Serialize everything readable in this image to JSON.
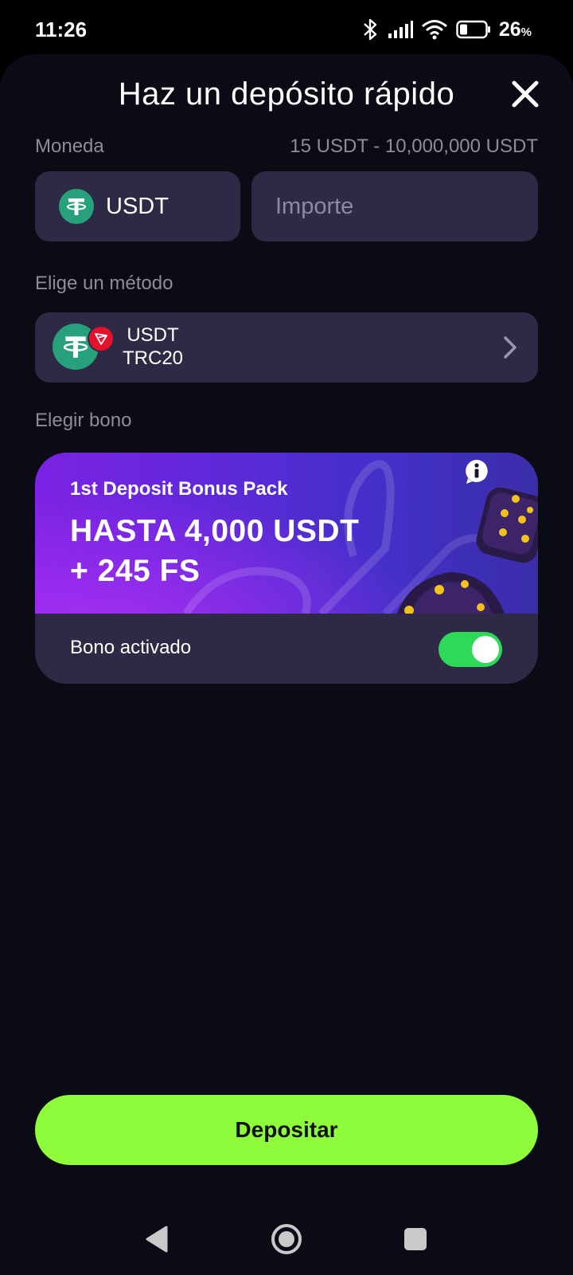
{
  "status_bar": {
    "time": "11:26",
    "battery_percent": "26",
    "battery_unit": "%",
    "icons": [
      "bluetooth-icon",
      "signal-icon",
      "wifi-icon",
      "battery-icon"
    ]
  },
  "header": {
    "title": "Haz un depósito rápido",
    "close_icon": "close-icon"
  },
  "currency": {
    "label": "Moneda",
    "range": "15 USDT - 10,000,000 USDT",
    "selected": "USDT",
    "coin_icon": "tether-icon"
  },
  "amount": {
    "placeholder": "Importe",
    "value": ""
  },
  "method": {
    "label": "Elige un método",
    "name_line1": "USDT",
    "name_line2": "TRC20",
    "badge_icon": "tron-icon",
    "arrow_icon": "chevron-right-icon"
  },
  "bonus": {
    "label": "Elegir bono",
    "subtitle": "1st Deposit Bonus Pack",
    "title_line1": "HASTA 4,000 USDT",
    "title_line2": "+ 245 FS",
    "info_icon": "info-icon",
    "toggle_label": "Bono activado",
    "toggle_on": true
  },
  "actions": {
    "deposit_label": "Depositar"
  },
  "nav": {
    "back_icon": "back-icon",
    "home_icon": "home-icon",
    "recents_icon": "recents-icon"
  },
  "colors": {
    "background": "#0b0b16",
    "card": "#2e2a45",
    "accent": "#8efc3a",
    "toggle": "#2ed95a",
    "tether": "#26a17b",
    "tron": "#e5112d"
  }
}
